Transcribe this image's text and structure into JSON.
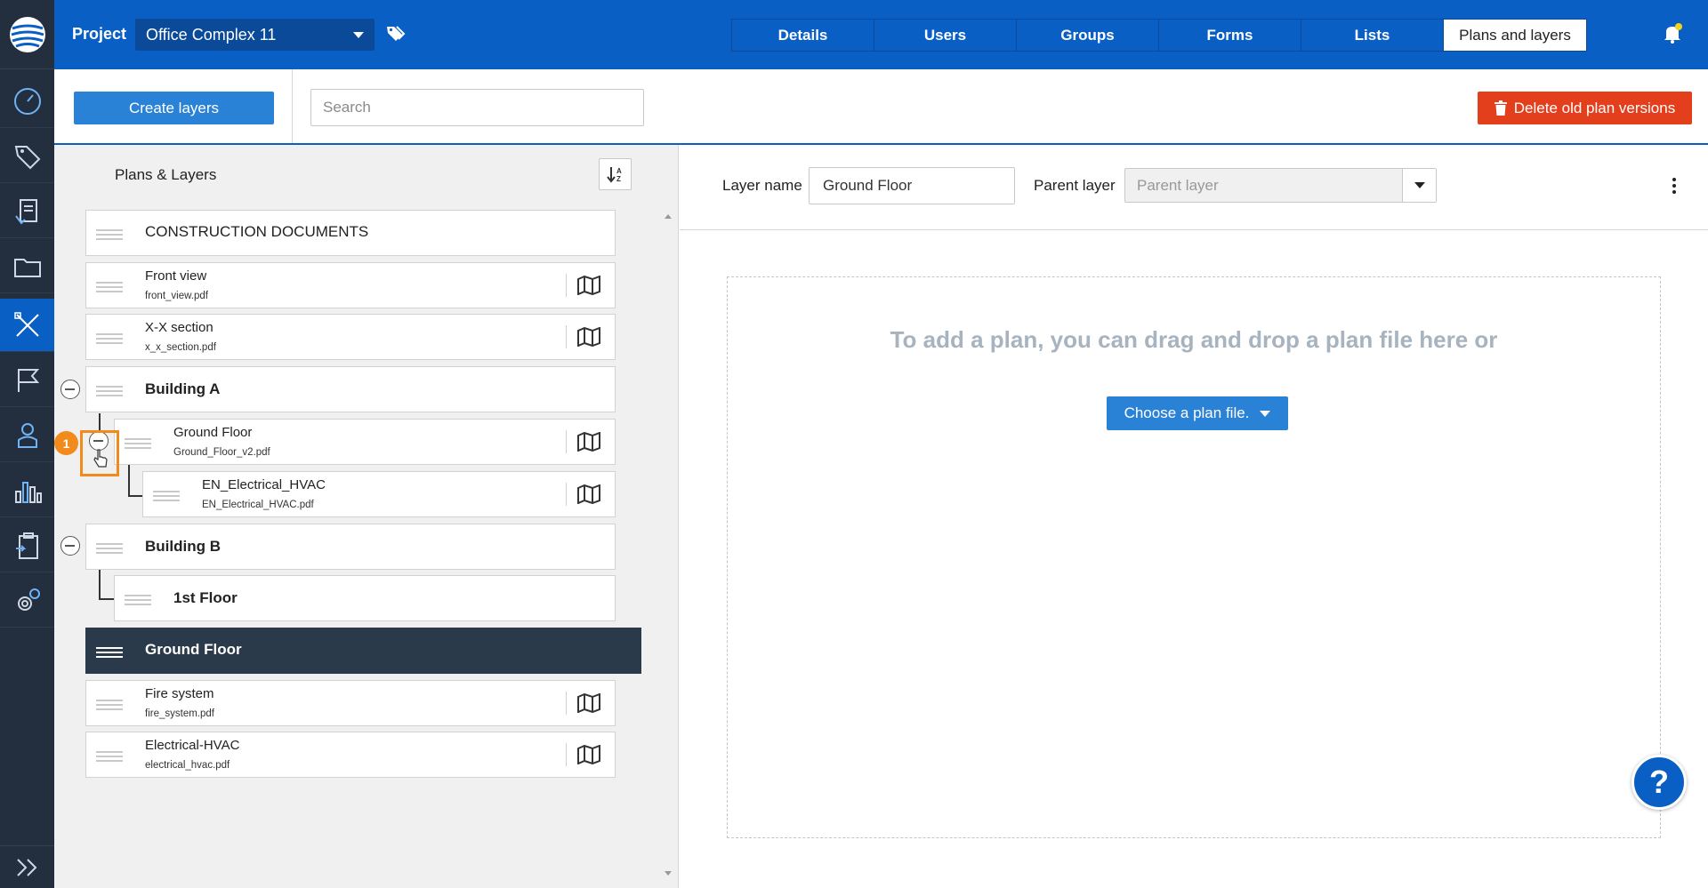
{
  "topbar": {
    "project_label": "Project",
    "project_value": "Office Complex 11",
    "tabs": [
      {
        "label": "Details"
      },
      {
        "label": "Users"
      },
      {
        "label": "Groups"
      },
      {
        "label": "Forms"
      },
      {
        "label": "Lists"
      },
      {
        "label": "Plans and layers"
      }
    ],
    "active_tab": "Plans and layers"
  },
  "toolbar": {
    "create_label": "Create layers",
    "search_placeholder": "Search",
    "delete_label": "Delete old plan versions"
  },
  "left": {
    "title": "Plans & Layers",
    "rows": [
      {
        "title": "CONSTRUCTION DOCUMENTS"
      },
      {
        "name": "Front view",
        "file": "front_view.pdf"
      },
      {
        "name": "X-X section",
        "file": "x_x_section.pdf"
      },
      {
        "title": "Building A"
      },
      {
        "name": "Ground Floor",
        "file": "Ground_Floor_v2.pdf"
      },
      {
        "name": "EN_Electrical_HVAC",
        "file": "EN_Electrical_HVAC.pdf"
      },
      {
        "title": "Building B"
      },
      {
        "title": "1st Floor"
      },
      {
        "title": "Ground Floor"
      },
      {
        "name": "Fire system",
        "file": "fire_system.pdf"
      },
      {
        "name": "Electrical-HVAC",
        "file": "electrical_hvac.pdf"
      }
    ],
    "step_badge": "1"
  },
  "right": {
    "layer_name_label": "Layer name",
    "layer_name_value": "Ground Floor",
    "parent_label": "Parent layer",
    "parent_placeholder": "Parent layer",
    "drop_text": "To add a plan, you can drag and drop a plan file here or",
    "choose_label": "Choose a plan file."
  },
  "help_label": "?",
  "colors": {
    "primary": "#0a5fc4",
    "rail": "#232f3e",
    "danger": "#e43f1c",
    "selected_row": "#2b3a4a",
    "highlight": "#f28a1c",
    "notification_dot": "#f5d21c"
  }
}
